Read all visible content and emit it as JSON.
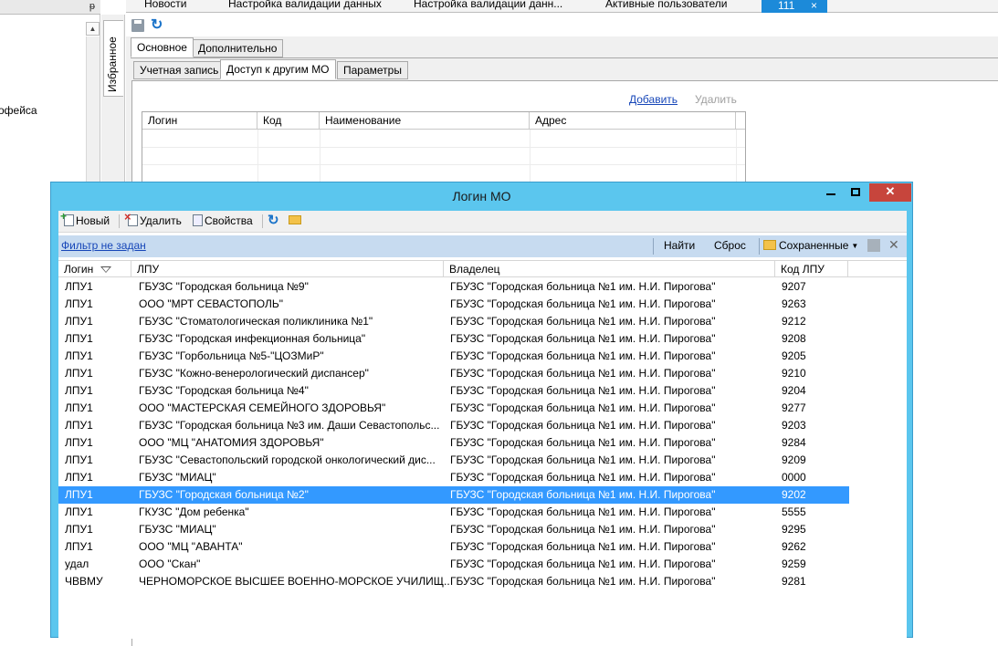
{
  "left_panel": {
    "item": "офейса",
    "pin_icon": "pin-icon"
  },
  "favorites": {
    "label": "Избранное"
  },
  "doc_tabs": [
    {
      "label": "Новости"
    },
    {
      "label": "Настройка валидации данных"
    },
    {
      "label": "Настройка валидации данн..."
    },
    {
      "label": "Активные пользователи"
    }
  ],
  "active_doc_tab": {
    "label": "111",
    "close": "×"
  },
  "form_tabs": {
    "main": "Основное",
    "extra": "Дополнительно"
  },
  "sub_tabs": {
    "account": "Учетная запись",
    "access": "Доступ к другим МО",
    "params": "Параметры"
  },
  "access_actions": {
    "add": "Добавить",
    "delete": "Удалить"
  },
  "access_grid": {
    "columns": [
      "Логин",
      "Код",
      "Наименование",
      "Адрес"
    ]
  },
  "dialog": {
    "title": "Логин МО",
    "toolbar": {
      "new": "Новый",
      "delete": "Удалить",
      "properties": "Свойства"
    },
    "filter": {
      "link": "Фильтр не задан",
      "find": "Найти",
      "reset": "Сброс",
      "saved": "Сохраненные"
    },
    "columns": {
      "login": "Логин",
      "lpu": "ЛПУ",
      "owner": "Владелец",
      "code": "Код ЛПУ"
    },
    "rows": [
      {
        "login": "ЛПУ1",
        "lpu": "ГБУЗС \"Городская больница №9\"",
        "owner": "ГБУЗС \"Городская больница №1 им. Н.И. Пирогова\"",
        "code": "9207"
      },
      {
        "login": "ЛПУ1",
        "lpu": "ООО \"МРТ СЕВАСТОПОЛЬ\"",
        "owner": "ГБУЗС \"Городская больница №1 им. Н.И. Пирогова\"",
        "code": "9263"
      },
      {
        "login": "ЛПУ1",
        "lpu": "ГБУЗС \"Стоматологическая поликлиника №1\"",
        "owner": "ГБУЗС \"Городская больница №1 им. Н.И. Пирогова\"",
        "code": "9212"
      },
      {
        "login": "ЛПУ1",
        "lpu": "ГБУЗС \"Городская инфекционная больница\"",
        "owner": "ГБУЗС \"Городская больница №1 им. Н.И. Пирогова\"",
        "code": "9208"
      },
      {
        "login": "ЛПУ1",
        "lpu": "ГБУЗС \"Горбольница №5-\"ЦОЗМиР\"",
        "owner": "ГБУЗС \"Городская больница №1 им. Н.И. Пирогова\"",
        "code": "9205"
      },
      {
        "login": "ЛПУ1",
        "lpu": "ГБУЗС \"Кожно-венерологический диспансер\"",
        "owner": "ГБУЗС \"Городская больница №1 им. Н.И. Пирогова\"",
        "code": "9210"
      },
      {
        "login": "ЛПУ1",
        "lpu": "ГБУЗС \"Городская больница №4\"",
        "owner": "ГБУЗС \"Городская больница №1 им. Н.И. Пирогова\"",
        "code": "9204"
      },
      {
        "login": "ЛПУ1",
        "lpu": "ООО \"МАСТЕРСКАЯ СЕМЕЙНОГО ЗДОРОВЬЯ\"",
        "owner": "ГБУЗС \"Городская больница №1 им. Н.И. Пирогова\"",
        "code": "9277"
      },
      {
        "login": "ЛПУ1",
        "lpu": "ГБУЗС \"Городская больница №3 им. Даши Севастопольс...",
        "owner": "ГБУЗС \"Городская больница №1 им. Н.И. Пирогова\"",
        "code": "9203"
      },
      {
        "login": "ЛПУ1",
        "lpu": "ООО \"МЦ \"АНАТОМИЯ ЗДОРОВЬЯ\"",
        "owner": "ГБУЗС \"Городская больница №1 им. Н.И. Пирогова\"",
        "code": "9284"
      },
      {
        "login": "ЛПУ1",
        "lpu": "ГБУЗС \"Севастопольский городской онкологический дис...",
        "owner": "ГБУЗС \"Городская больница №1 им. Н.И. Пирогова\"",
        "code": "9209"
      },
      {
        "login": "ЛПУ1",
        "lpu": "ГБУЗС \"МИАЦ\"",
        "owner": "ГБУЗС \"Городская больница №1 им. Н.И. Пирогова\"",
        "code": "0000"
      },
      {
        "login": "ЛПУ1",
        "lpu": "ГБУЗС \"Городская больница №2\"",
        "owner": "ГБУЗС \"Городская больница №1 им. Н.И. Пирогова\"",
        "code": "9202",
        "selected": true
      },
      {
        "login": "ЛПУ1",
        "lpu": "ГКУЗС \"Дом ребенка\"",
        "owner": "ГБУЗС \"Городская больница №1 им. Н.И. Пирогова\"",
        "code": "5555"
      },
      {
        "login": "ЛПУ1",
        "lpu": "ГБУЗС \"МИАЦ\"",
        "owner": "ГБУЗС \"Городская больница №1 им. Н.И. Пирогова\"",
        "code": "9295"
      },
      {
        "login": "ЛПУ1",
        "lpu": "ООО \"МЦ \"АВАНТА\"",
        "owner": "ГБУЗС \"Городская больница №1 им. Н.И. Пирогова\"",
        "code": "9262"
      },
      {
        "login": "удал",
        "lpu": "ООО \"Скан\"",
        "owner": "ГБУЗС \"Городская больница №1 им. Н.И. Пирогова\"",
        "code": "9259"
      },
      {
        "login": "ЧВВМУ",
        "lpu": "ЧЕРНОМОРСКОЕ ВЫСШЕЕ ВОЕННО-МОРСКОЕ УЧИЛИЩ...",
        "owner": "ГБУЗС \"Городская больница №1 им. Н.И. Пирогова\"",
        "code": "9281"
      }
    ]
  },
  "colors": {
    "dialog_frame": "#5bc6ee",
    "selection": "#3399ff",
    "active_tab": "#1c8ad9",
    "close_button": "#c7453c"
  }
}
